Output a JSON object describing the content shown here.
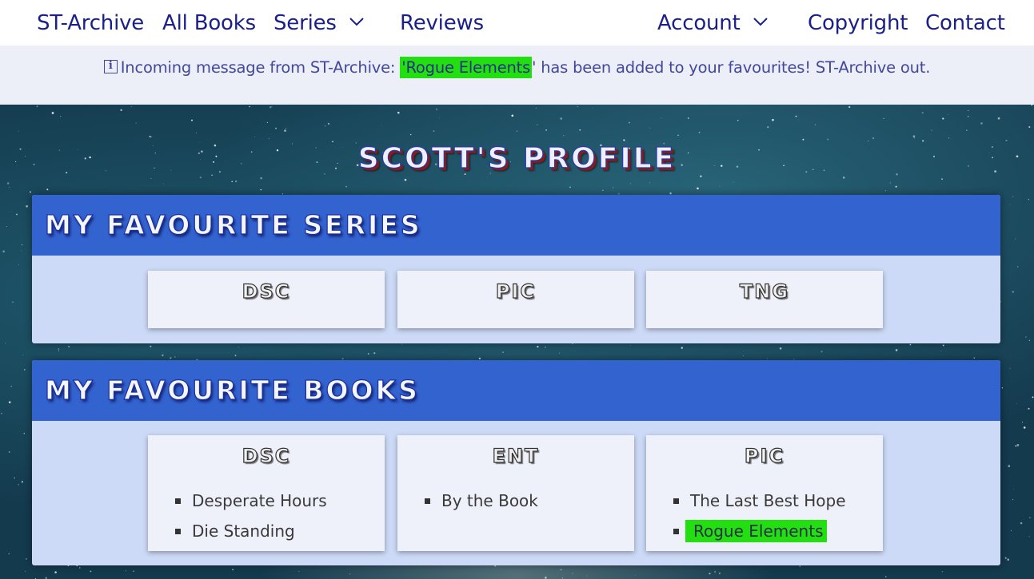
{
  "nav": {
    "brand": "ST-Archive",
    "all_books": "All Books",
    "series": "Series",
    "reviews": "Reviews",
    "account": "Account",
    "copyright": "Copyright",
    "contact": "Contact"
  },
  "alert": {
    "prefix": "Incoming message from ST-Archive:",
    "book": "'Rogue Elements",
    "suffix": "' has been added to your favourites! ST-Archive out.",
    "highlight_color": "#22e010"
  },
  "profile": {
    "title": "Scott's Profile"
  },
  "favourite_series": {
    "heading": "My Favourite Series",
    "items": [
      "DSC",
      "PIC",
      "TNG"
    ]
  },
  "favourite_books": {
    "heading": "My Favourite Books",
    "groups": [
      {
        "series": "DSC",
        "books": [
          "Desperate Hours",
          "Die Standing"
        ]
      },
      {
        "series": "ENT",
        "books": [
          "By the Book"
        ]
      },
      {
        "series": "PIC",
        "books": [
          "The Last Best Hope",
          "Rogue Elements"
        ]
      }
    ]
  },
  "colors": {
    "nav_text": "#1a1f8a",
    "panel_header": "#3363cf",
    "panel_body": "#ccdaf7",
    "card_bg": "#eef0fa"
  }
}
